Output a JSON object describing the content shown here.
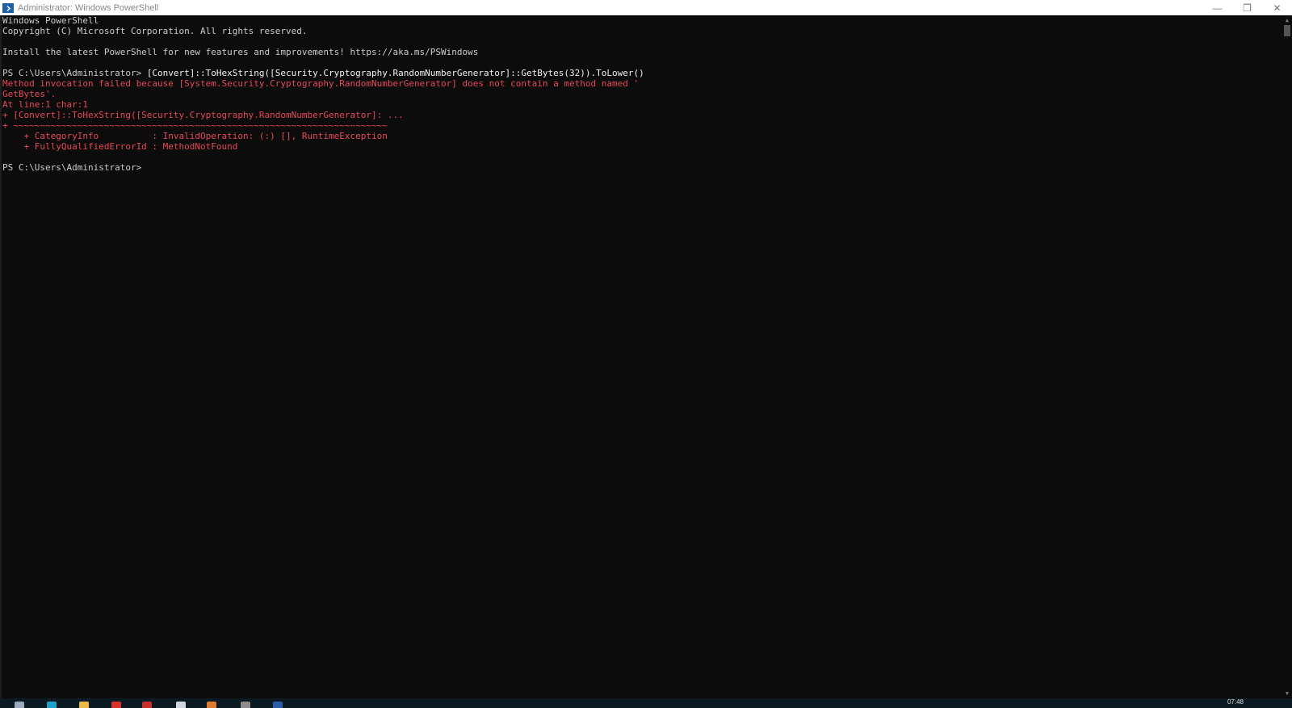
{
  "window": {
    "title": "Administrator: Windows PowerShell",
    "controls": {
      "minimize": "—",
      "restore": "❐",
      "close": "✕"
    }
  },
  "console": {
    "lines": [
      {
        "text": "Windows PowerShell",
        "type": "normal"
      },
      {
        "text": "Copyright (C) Microsoft Corporation. All rights reserved.",
        "type": "normal"
      },
      {
        "text": "",
        "type": "normal"
      },
      {
        "text": "Install the latest PowerShell for new features and improvements! https://aka.ms/PSWindows",
        "type": "normal"
      },
      {
        "text": "",
        "type": "normal"
      },
      {
        "prompt": "PS C:\\Users\\Administrator> ",
        "command": "[Convert]::ToHexString([Security.Cryptography.RandomNumberGenerator]::GetBytes(32)).ToLower()",
        "type": "command"
      },
      {
        "text": "Method invocation failed because [System.Security.Cryptography.RandomNumberGenerator] does not contain a method named '",
        "type": "error"
      },
      {
        "text": "GetBytes'.",
        "type": "error"
      },
      {
        "text": "At line:1 char:1",
        "type": "error"
      },
      {
        "text": "+ [Convert]::ToHexString([Security.Cryptography.RandomNumberGenerator]: ...",
        "type": "error"
      },
      {
        "text": "+ ~~~~~~~~~~~~~~~~~~~~~~~~~~~~~~~~~~~~~~~~~~~~~~~~~~~~~~~~~~~~~~~~~~~~~~",
        "type": "error"
      },
      {
        "text": "    + CategoryInfo          : InvalidOperation: (:) [], RuntimeException",
        "type": "error"
      },
      {
        "text": "    + FullyQualifiedErrorId : MethodNotFound",
        "type": "error"
      },
      {
        "text": "",
        "type": "normal"
      },
      {
        "prompt": "PS C:\\Users\\Administrator> ",
        "command": "",
        "type": "command"
      }
    ]
  },
  "taskbar": {
    "clock": "07:48",
    "icons": [
      {
        "name": "start-icon",
        "color": "#9ab"
      },
      {
        "name": "edge-icon",
        "color": "#1fa0c8"
      },
      {
        "name": "explorer-icon",
        "color": "#e8b84a"
      },
      {
        "name": "chrome-icon",
        "color": "#d8322c"
      },
      {
        "name": "app-red-icon",
        "color": "#c8302c"
      },
      {
        "name": "notepad-icon",
        "color": "#cfd6dd"
      },
      {
        "name": "app-orange-icon",
        "color": "#e07a2e"
      },
      {
        "name": "app-gray-icon",
        "color": "#8c8c8c"
      },
      {
        "name": "powershell-icon",
        "color": "#2a5ea8"
      }
    ]
  },
  "colors": {
    "background": "#0c0c0c",
    "text": "#cccccc",
    "error": "#e74856"
  }
}
